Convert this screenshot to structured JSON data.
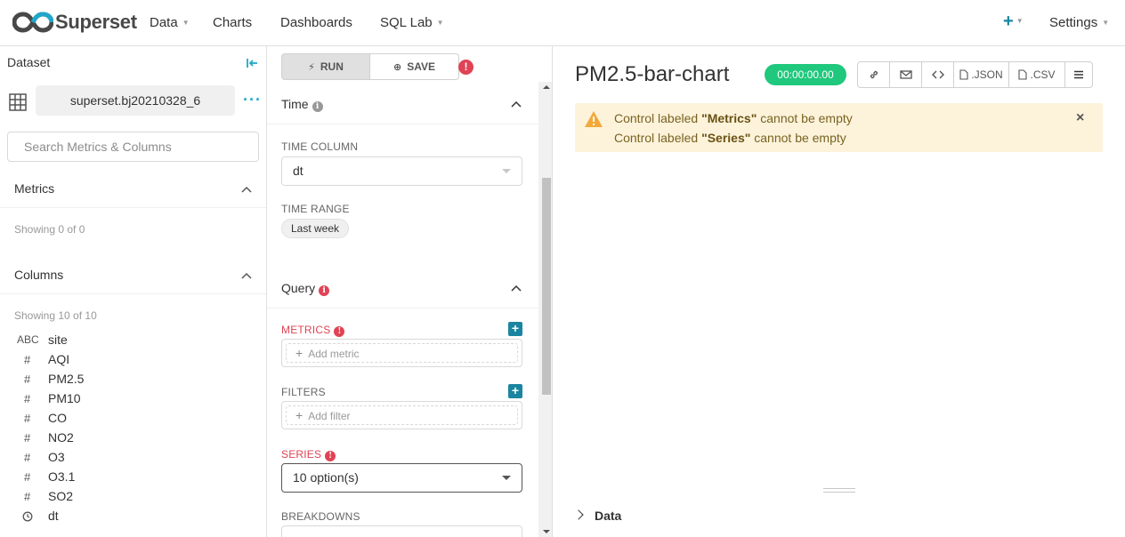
{
  "nav": {
    "brand": "Superset",
    "items": [
      {
        "label": "Data",
        "dropdown": true
      },
      {
        "label": "Charts",
        "dropdown": false
      },
      {
        "label": "Dashboards",
        "dropdown": false
      },
      {
        "label": "SQL Lab",
        "dropdown": true
      }
    ],
    "plus_icon": "plus-icon",
    "settings_label": "Settings"
  },
  "dataset": {
    "title": "Dataset",
    "name": "superset.bj20210328_6",
    "more": "···",
    "search_placeholder": "Search Metrics & Columns",
    "metrics": {
      "label": "Metrics",
      "showing": "Showing 0 of 0"
    },
    "columns": {
      "label": "Columns",
      "showing": "Showing 10 of 10",
      "items": [
        {
          "type": "ABC",
          "name": "site"
        },
        {
          "type": "#",
          "name": "AQI"
        },
        {
          "type": "#",
          "name": "PM2.5"
        },
        {
          "type": "#",
          "name": "PM10"
        },
        {
          "type": "#",
          "name": "CO"
        },
        {
          "type": "#",
          "name": "NO2"
        },
        {
          "type": "#",
          "name": "O3"
        },
        {
          "type": "#",
          "name": "O3.1"
        },
        {
          "type": "#",
          "name": "SO2"
        },
        {
          "type": "clock",
          "name": "dt"
        }
      ]
    }
  },
  "controls": {
    "run_label": "RUN",
    "save_label": "SAVE",
    "time": {
      "label": "Time",
      "time_column_label": "TIME COLUMN",
      "time_column_value": "dt",
      "time_range_label": "TIME RANGE",
      "time_range_value": "Last week"
    },
    "query": {
      "label": "Query",
      "metrics_label": "METRICS",
      "metrics_placeholder": "Add metric",
      "filters_label": "FILTERS",
      "filters_placeholder": "Add filter",
      "series_label": "SERIES",
      "series_value": "10 option(s)",
      "breakdowns_label": "BREAKDOWNS"
    }
  },
  "chart": {
    "title": "PM2.5-bar-chart",
    "timer": "00:00:00.00",
    "actions": [
      {
        "icon": "link-icon",
        "label": ""
      },
      {
        "icon": "mail-icon",
        "label": ""
      },
      {
        "icon": "code-icon",
        "label": ""
      },
      {
        "icon": "file-icon",
        "label": ".JSON"
      },
      {
        "icon": "file-icon",
        "label": ".CSV"
      },
      {
        "icon": "menu-icon",
        "label": ""
      }
    ],
    "alert": {
      "line1_prefix": "Control labeled ",
      "line1_bold": "\"Metrics\"",
      "line1_suffix": " cannot be empty",
      "line2_prefix": "Control labeled ",
      "line2_bold": "\"Series\"",
      "line2_suffix": " cannot be empty"
    },
    "data_label": "Data"
  },
  "colors": {
    "accent": "#1a85a0",
    "success": "#1fc87c",
    "error": "#e04355",
    "warning_bg": "#fcf3da",
    "warning_icon": "#f2a93b"
  }
}
